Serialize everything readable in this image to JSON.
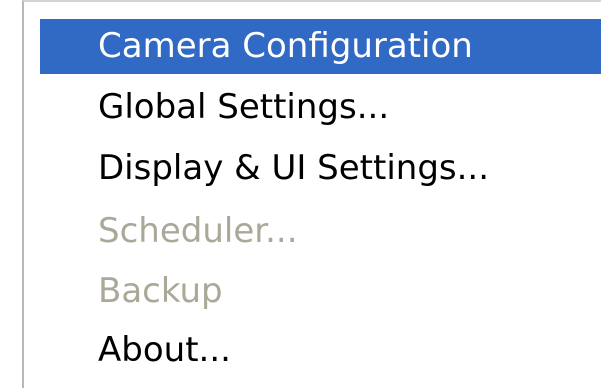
{
  "context_menu": {
    "items": [
      {
        "label": "Camera Configuration",
        "state": "highlighted"
      },
      {
        "label": "Global Settings...",
        "state": "enabled"
      },
      {
        "label": "Display & UI Settings...",
        "state": "enabled"
      },
      {
        "label": "Scheduler...",
        "state": "disabled"
      },
      {
        "label": "Backup",
        "state": "disabled"
      },
      {
        "label": "About...",
        "state": "enabled"
      }
    ]
  },
  "colors": {
    "highlight_background": "#316ac5",
    "highlight_text": "#ffffff",
    "enabled_text": "#000000",
    "disabled_text": "#aca899"
  }
}
